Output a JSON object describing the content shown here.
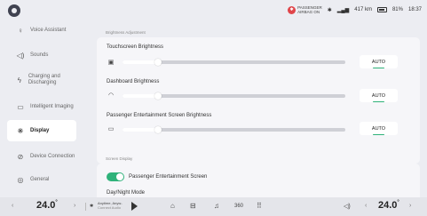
{
  "status": {
    "airbag_line1": "PASSENGER",
    "airbag_line2": "AIRBAG ON",
    "range": "417 km",
    "battery": "81%",
    "battery_level": 0.81,
    "time": "18:37"
  },
  "sidebar": {
    "items": [
      {
        "label": "Voice Assistant",
        "icon": "voice-icon"
      },
      {
        "label": "Sounds",
        "icon": "speaker-icon"
      },
      {
        "label": "Charging and Discharging",
        "icon": "charging-icon"
      },
      {
        "label": "Intelligent Imaging",
        "icon": "camera-icon"
      },
      {
        "label": "Display",
        "icon": "brightness-icon",
        "active": true
      },
      {
        "label": "Device Connection",
        "icon": "link-icon"
      },
      {
        "label": "General",
        "icon": "general-icon"
      }
    ]
  },
  "main": {
    "brightness_section_title": "Brightness Adjustment",
    "rows": [
      {
        "label": "Touchscreen Brightness",
        "icon": "screen-icon",
        "level": 0.16,
        "auto_label": "AUTO"
      },
      {
        "label": "Dashboard Brightness",
        "icon": "dashboard-icon",
        "level": 0.16,
        "auto_label": "AUTO"
      },
      {
        "label": "Passenger Entertainment Screen Brightness",
        "icon": "passenger-screen-icon",
        "level": 0.16,
        "auto_label": "AUTO"
      }
    ],
    "screen_display_title": "Screen Display",
    "passenger_screen_toggle_label": "Passenger Entertainment Screen",
    "passenger_screen_on": true,
    "day_night_label": "Day/Night Mode"
  },
  "dock": {
    "left_temp": "24.0",
    "right_temp": "24.0",
    "degree": "°",
    "media_title": "Anytime, Anyw..",
    "media_subtitle": "Connect Audio",
    "accent": "#2fb27a"
  }
}
